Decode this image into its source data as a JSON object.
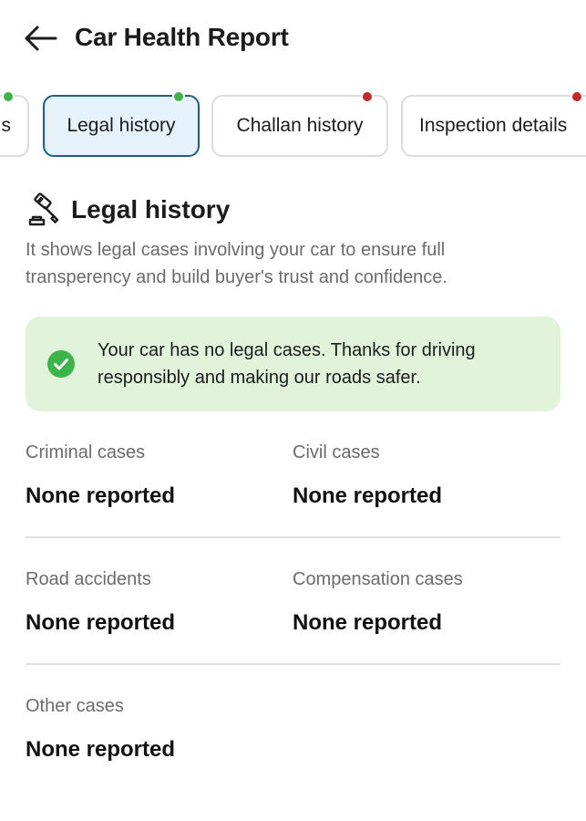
{
  "header": {
    "title": "Car Health Report"
  },
  "tabs": [
    {
      "label": "s",
      "status_color": "#3bb54a"
    },
    {
      "label": "Legal history",
      "status_color": "#3bb54a",
      "active": true
    },
    {
      "label": "Challan history",
      "status_color": "#c62828"
    },
    {
      "label": "Inspection details",
      "status_color": "#c62828"
    }
  ],
  "section": {
    "title": "Legal history",
    "icon": "gavel-icon",
    "description": "It shows legal cases involving your car to ensure full transperency and build buyer's trust and confidence."
  },
  "notice": {
    "icon": "check-circle-icon",
    "text": "Your car has no legal cases. Thanks for driving responsibly and making our roads safer."
  },
  "cases": [
    {
      "label": "Criminal cases",
      "value": "None reported"
    },
    {
      "label": "Civil cases",
      "value": "None reported"
    },
    {
      "label": "Road accidents",
      "value": "None reported"
    },
    {
      "label": "Compensation cases",
      "value": "None reported"
    },
    {
      "label": "Other cases",
      "value": "None reported"
    }
  ],
  "colors": {
    "active_tab_bg": "#e6f2fb",
    "active_tab_border": "#1b5e8c",
    "notice_bg": "#e1f4db",
    "success_green": "#3bb54a",
    "alert_red": "#c62828"
  }
}
